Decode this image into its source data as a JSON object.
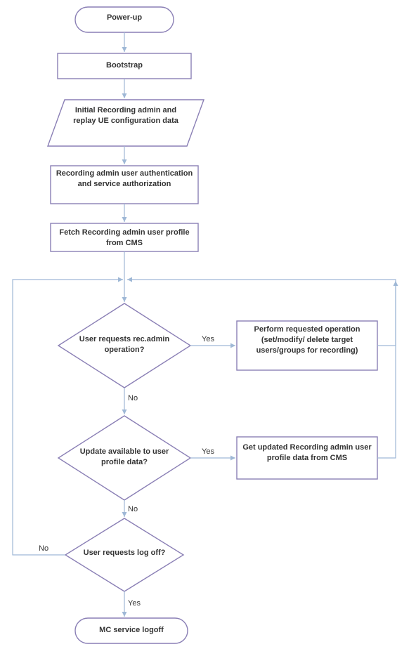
{
  "nodes": {
    "powerup": "Power-up",
    "bootstrap": "Bootstrap",
    "initialCfg": "Initial Recording admin and replay UE configuration data",
    "authz": "Recording admin user authentication and service authorization",
    "fetchProfile": "Fetch Recording admin user profile from CMS",
    "decRecAdmin": "User requests rec.admin operation?",
    "performOp": "Perform requested operation (set/modify/ delete target users/groups for recording)",
    "decUpdate": "Update available to user profile data?",
    "getUpdated": "Get updated Recording admin user profile data from CMS",
    "decLogoff": "User requests log off?",
    "logoff": "MC service logoff"
  },
  "labels": {
    "yes": "Yes",
    "no": "No"
  }
}
